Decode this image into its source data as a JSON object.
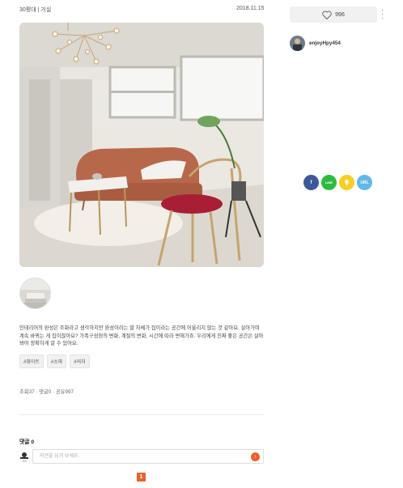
{
  "post": {
    "category": "30평대 | 거실",
    "date": "2018.11.15",
    "description": "인테리어의 완성은 조화라고 생각하지만 완성이라는 말 자체가 집이라는 공간에 어울리지 않는 것 같아요. 살아가며 계속 바뀌는 게 집이잖아요? 가족구성원의 변화, 계절의 변화, 시간에 따라 변해가죠. 우리에게 진짜 좋은 공간은 살아봐야 정확하게 알 수 있어요.",
    "tags": [
      "#화이트",
      "#소파",
      "#의자"
    ],
    "stats": "조회37 · 댓글0 · 공유997"
  },
  "comments": {
    "title": "댓글 0",
    "placeholder": "의견을 남겨 보세요.",
    "send_icon": "arrow-right-icon"
  },
  "pagination": {
    "current": "1"
  },
  "sidebar": {
    "like_count": "996",
    "author": "enjoyHpy454",
    "share": [
      {
        "name": "facebook",
        "label": "f",
        "color": "#3b5998"
      },
      {
        "name": "line",
        "label": "LINE",
        "color": "#2dbb3f"
      },
      {
        "name": "kakao",
        "label": "",
        "color": "#f7cf22"
      },
      {
        "name": "url",
        "label": "URL",
        "color": "#5eb9e8"
      }
    ]
  },
  "colors": {
    "accent": "#e8622c"
  }
}
